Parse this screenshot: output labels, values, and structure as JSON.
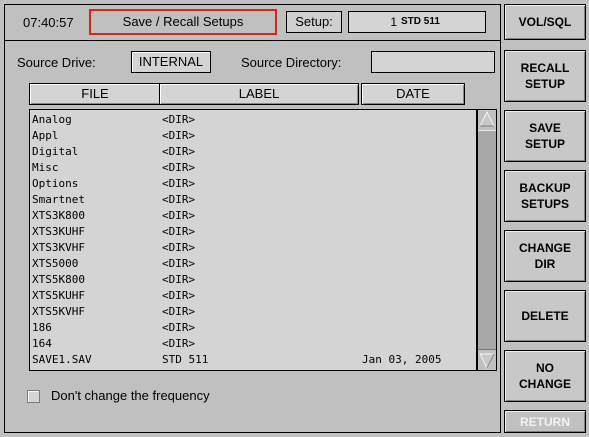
{
  "header": {
    "time": "07:40:57",
    "title": "Save / Recall Setups",
    "setup_label": "Setup:",
    "setup_number": "1",
    "setup_name": "STD 511"
  },
  "source": {
    "drive_label": "Source Drive:",
    "drive_value": "INTERNAL",
    "directory_label": "Source Directory:",
    "directory_value": ""
  },
  "columns": {
    "file": "FILE",
    "label": "LABEL",
    "date": "DATE"
  },
  "files": [
    {
      "file": "Analog",
      "label": "<DIR>",
      "date": ""
    },
    {
      "file": "Appl",
      "label": "<DIR>",
      "date": ""
    },
    {
      "file": "Digital",
      "label": "<DIR>",
      "date": ""
    },
    {
      "file": "Misc",
      "label": "<DIR>",
      "date": ""
    },
    {
      "file": "Options",
      "label": "<DIR>",
      "date": ""
    },
    {
      "file": "Smartnet",
      "label": "<DIR>",
      "date": ""
    },
    {
      "file": "XTS3K800",
      "label": "<DIR>",
      "date": ""
    },
    {
      "file": "XTS3KUHF",
      "label": "<DIR>",
      "date": ""
    },
    {
      "file": "XTS3KVHF",
      "label": "<DIR>",
      "date": ""
    },
    {
      "file": "XTS5000",
      "label": "<DIR>",
      "date": ""
    },
    {
      "file": "XTS5K800",
      "label": "<DIR>",
      "date": ""
    },
    {
      "file": "XTS5KUHF",
      "label": "<DIR>",
      "date": ""
    },
    {
      "file": "XTS5KVHF",
      "label": "<DIR>",
      "date": ""
    },
    {
      "file": "186",
      "label": "<DIR>",
      "date": ""
    },
    {
      "file": "164",
      "label": "<DIR>",
      "date": ""
    },
    {
      "file": "SAVE1.SAV",
      "label": "STD 511",
      "date": "Jan 03, 2005"
    }
  ],
  "checkbox": {
    "label": "Don't change the frequency",
    "checked": false
  },
  "sidebar": {
    "vol_sql": "VOL/SQL",
    "recall_setup": "RECALL\nSETUP",
    "save_setup": "SAVE\nSETUP",
    "backup_setups": "BACKUP\nSETUPS",
    "change_dir": "CHANGE\nDIR",
    "delete": "DELETE",
    "no_change": "NO\nCHANGE",
    "return": "RETURN"
  },
  "colors": {
    "background": "#c0c0c0",
    "title_border": "#e0201c",
    "disabled_text": "#f2f2f2"
  }
}
